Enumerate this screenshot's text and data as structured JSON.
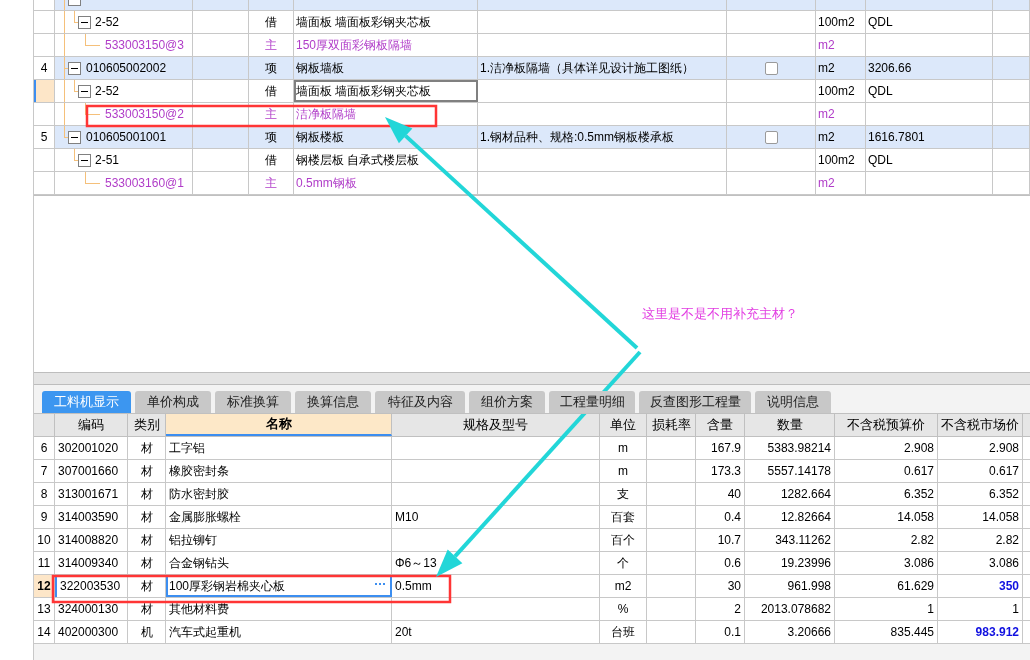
{
  "bill_grid": {
    "rows": [
      {
        "kind": "list",
        "expanded": true,
        "selected": false,
        "children": [
          {
            "kind": "norm",
            "code": "2-52",
            "type": "借",
            "name": "墙面板 墙面板彩钢夹芯板",
            "unit": "100m2",
            "qty": "QDL",
            "expanded": true,
            "selected": false,
            "children": [
              {
                "kind": "material",
                "code": "533003150@3",
                "type": "主",
                "name": "150厚双面彩钢板隔墙",
                "unit": "m2",
                "selected": false
              }
            ]
          }
        ]
      },
      {
        "kind": "list",
        "index": "4",
        "code": "010605002002",
        "type": "项",
        "name": "钢板墙板",
        "desc": "1.洁净板隔墙（具体详见设计施工图纸）",
        "checked": false,
        "unit": "m2",
        "qty": "3206.66",
        "expanded": true,
        "selected": false,
        "children": [
          {
            "kind": "norm",
            "code": "2-52",
            "type": "借",
            "name": "墙面板 墙面板彩钢夹芯板",
            "unit": "100m2",
            "qty": "QDL",
            "expanded": true,
            "selected": true,
            "children": [
              {
                "kind": "material",
                "code": "533003150@2",
                "type": "主",
                "name": "洁净板隔墙",
                "unit": "m2",
                "selected": false
              }
            ]
          }
        ]
      },
      {
        "kind": "list",
        "index": "5",
        "code": "010605001001",
        "type": "项",
        "name": "钢板楼板",
        "desc": "1.钢材品种、规格:0.5mm钢板楼承板",
        "checked": false,
        "unit": "m2",
        "qty": "1616.7801",
        "expanded": true,
        "selected": false,
        "children": [
          {
            "kind": "norm",
            "code": "2-51",
            "type": "借",
            "name": "钢楼层板 自承式楼层板",
            "unit": "100m2",
            "qty": "QDL",
            "expanded": true,
            "selected": false,
            "children": [
              {
                "kind": "material",
                "code": "533003160@1",
                "type": "主",
                "name": "0.5mm钢板",
                "unit": "m2",
                "selected": false
              }
            ]
          }
        ]
      }
    ]
  },
  "annotation": {
    "note": "这里是不是不用补充主材？"
  },
  "detail_tabs": [
    {
      "label": "工料机显示",
      "selected": true
    },
    {
      "label": "单价构成",
      "selected": false
    },
    {
      "label": "标准换算",
      "selected": false
    },
    {
      "label": "换算信息",
      "selected": false
    },
    {
      "label": "特征及内容",
      "selected": false
    },
    {
      "label": "组价方案",
      "selected": false
    },
    {
      "label": "工程量明细",
      "selected": false
    },
    {
      "label": "反查图形工程量",
      "selected": false
    },
    {
      "label": "说明信息",
      "selected": false
    }
  ],
  "resource_table": {
    "columns": [
      "编码",
      "类别",
      "名称",
      "规格及型号",
      "单位",
      "损耗率",
      "含量",
      "数量",
      "不含税预算价",
      "不含税市场价"
    ],
    "rows": [
      {
        "index": "6",
        "code": "302001020",
        "type": "材",
        "name": "工字铝",
        "spec": "",
        "unit": "m",
        "content": "167.9",
        "quantity": "5383.98214",
        "budget_price": "2.908",
        "market_price": "2.908",
        "adjusted": false,
        "selected": false
      },
      {
        "index": "7",
        "code": "307001660",
        "type": "材",
        "name": "橡胶密封条",
        "spec": "",
        "unit": "m",
        "content": "173.3",
        "quantity": "5557.14178",
        "budget_price": "0.617",
        "market_price": "0.617",
        "adjusted": false,
        "selected": false
      },
      {
        "index": "8",
        "code": "313001671",
        "type": "材",
        "name": "防水密封胶",
        "spec": "",
        "unit": "支",
        "content": "40",
        "quantity": "1282.664",
        "budget_price": "6.352",
        "market_price": "6.352",
        "adjusted": false,
        "selected": false
      },
      {
        "index": "9",
        "code": "314003590",
        "type": "材",
        "name": "金属膨胀螺栓",
        "spec": "M10",
        "unit": "百套",
        "content": "0.4",
        "quantity": "12.82664",
        "budget_price": "14.058",
        "market_price": "14.058",
        "adjusted": false,
        "selected": false
      },
      {
        "index": "10",
        "code": "314008820",
        "type": "材",
        "name": "铝拉铆钉",
        "spec": "",
        "unit": "百个",
        "content": "10.7",
        "quantity": "343.11262",
        "budget_price": "2.82",
        "market_price": "2.82",
        "adjusted": false,
        "selected": false
      },
      {
        "index": "11",
        "code": "314009340",
        "type": "材",
        "name": "合金钢钻头",
        "spec": "Φ6～13",
        "unit": "个",
        "content": "0.6",
        "quantity": "19.23996",
        "budget_price": "3.086",
        "market_price": "3.086",
        "adjusted": false,
        "selected": false
      },
      {
        "index": "12",
        "code": "322003530",
        "type": "材",
        "name": "100厚彩钢岩棉夹心板",
        "spec": "0.5mm",
        "unit": "m2",
        "content": "30",
        "quantity": "961.998",
        "budget_price": "61.629",
        "market_price": "350",
        "adjusted": true,
        "selected": true
      },
      {
        "index": "13",
        "code": "324000130",
        "type": "材",
        "name": "其他材料费",
        "spec": "",
        "unit": "%",
        "content": "2",
        "quantity": "2013.078682",
        "budget_price": "1",
        "market_price": "1",
        "adjusted": false,
        "selected": false
      },
      {
        "index": "14",
        "code": "402000300",
        "type": "机",
        "name": "汽车式起重机",
        "spec": "20t",
        "unit": "台班",
        "content": "0.1",
        "quantity": "3.20666",
        "budget_price": "835.445",
        "market_price": "983.912",
        "adjusted": true,
        "selected": false
      }
    ]
  }
}
